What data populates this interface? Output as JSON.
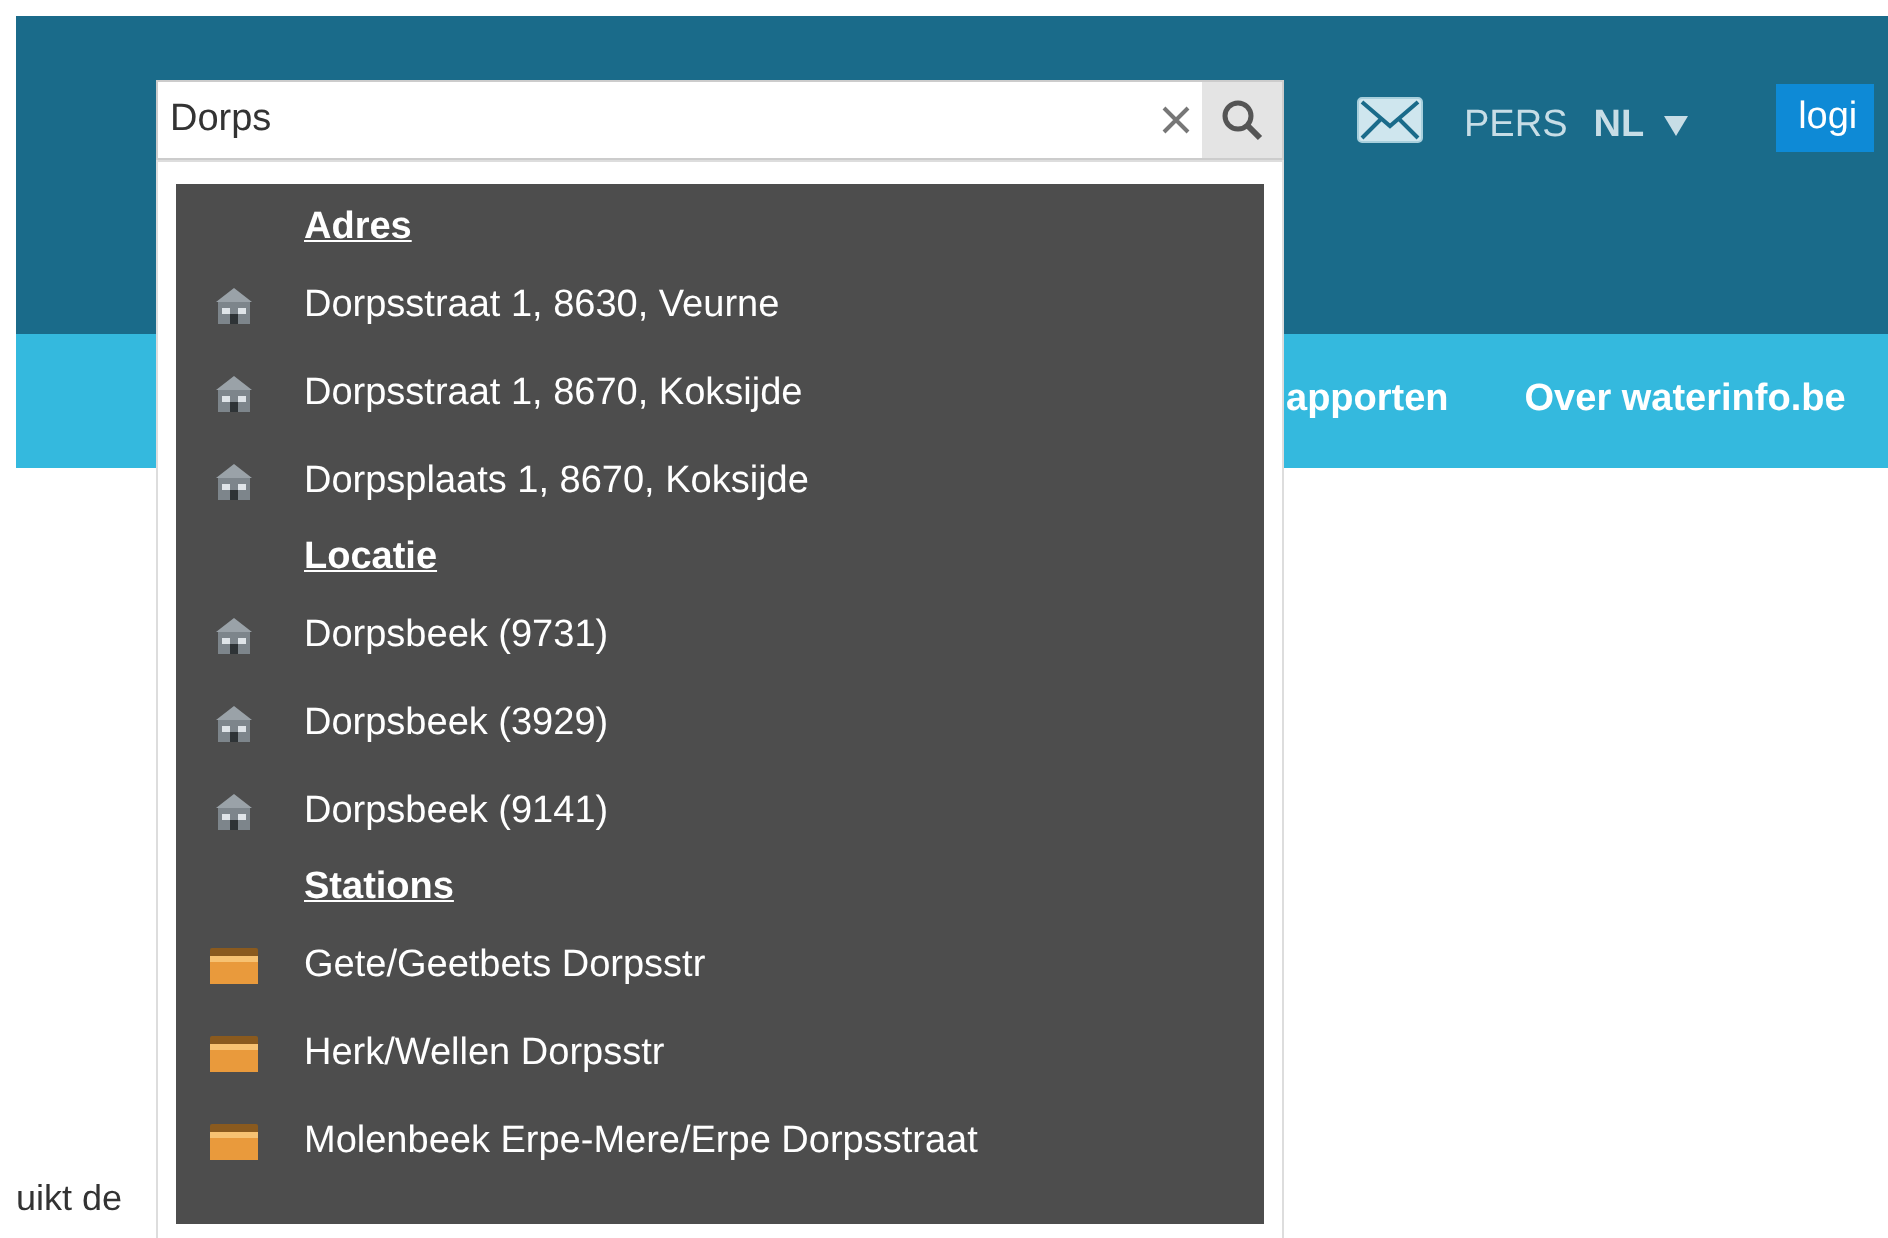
{
  "search": {
    "value": "Dorps"
  },
  "header": {
    "press": "PERS",
    "language": "NL",
    "login": "logi"
  },
  "nav": [
    "apporten",
    "Over waterinfo.be"
  ],
  "body_text": "uikt de",
  "suggestions": [
    {
      "heading": "Adres",
      "items": [
        {
          "label": "Dorpsstraat 1, 8630, Veurne",
          "kind": "place"
        },
        {
          "label": "Dorpsstraat 1, 8670, Koksijde",
          "kind": "place"
        },
        {
          "label": "Dorpsplaats 1, 8670, Koksijde",
          "kind": "place"
        }
      ]
    },
    {
      "heading": "Locatie",
      "items": [
        {
          "label": "Dorpsbeek (9731)",
          "kind": "place"
        },
        {
          "label": "Dorpsbeek (3929)",
          "kind": "place"
        },
        {
          "label": "Dorpsbeek (9141)",
          "kind": "place"
        }
      ]
    },
    {
      "heading": "Stations",
      "items": [
        {
          "label": "Gete/Geetbets Dorpsstr",
          "kind": "station"
        },
        {
          "label": "Herk/Wellen Dorpsstr",
          "kind": "station"
        },
        {
          "label": "Molenbeek Erpe-Mere/Erpe Dorpsstraat",
          "kind": "station"
        }
      ]
    }
  ]
}
